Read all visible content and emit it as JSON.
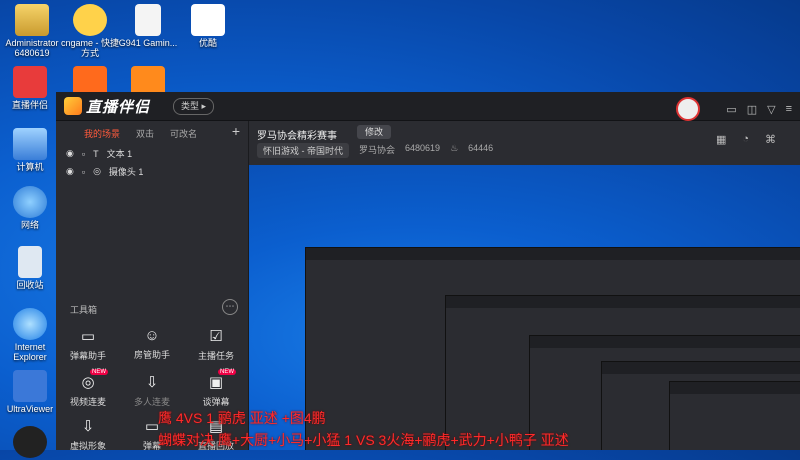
{
  "desktop": {
    "icons": [
      {
        "name": "administrator-icon",
        "label": "Administrator\n6480619",
        "color": "#4a8ad8"
      },
      {
        "name": "cngame-shortcut-icon",
        "label": "cngame - 快捷方式",
        "color": "#ffd24a"
      },
      {
        "name": "g941-file-icon",
        "label": "G941 Gamin...",
        "color": "#f2f2f2"
      },
      {
        "name": "youku-icon",
        "label": "优酷",
        "color": "#ffffff"
      },
      {
        "name": "zhibo-banlv-icon",
        "label": "直播伴侣",
        "color": "#e83b3b"
      },
      {
        "name": "game-icon-2",
        "label": "",
        "color": "#ff6a1c"
      },
      {
        "name": "game-icon-3",
        "label": "",
        "color": "#ff8a1c"
      },
      {
        "name": "computer-icon",
        "label": "计算机",
        "color": "#6fb1ff"
      },
      {
        "name": "network-icon",
        "label": "网络",
        "color": "#5ab0ff"
      },
      {
        "name": "recycle-bin-icon",
        "label": "回收站",
        "color": "#dfe8f2"
      },
      {
        "name": "ie-icon",
        "label": "Internet Explorer",
        "color": "#3fa4ff"
      },
      {
        "name": "ultraviewer-icon",
        "label": "UltraViewer",
        "color": "#3b78d8"
      },
      {
        "name": "qq-icon",
        "label": "",
        "color": "#222222"
      }
    ]
  },
  "app": {
    "logo_text": "直播伴侣",
    "type_label": "类型 ▸",
    "tabs": [
      "我的场景",
      "双击",
      "可改名"
    ],
    "sources": [
      "文本 1",
      "摄像头 1"
    ],
    "toolbox_title": "工具箱",
    "tools": [
      "弹幕助手",
      "房管助手",
      "主播任务",
      "视频连麦",
      "多人连麦",
      "谈弹幕",
      "虚拟形象",
      "弹幕",
      "直播回放"
    ],
    "room_title": "罗马协会精彩赛事",
    "edit_label": "修改",
    "category": "怀旧游戏 - 帝国时代",
    "room_name": "罗马协会",
    "room_id": "6480619",
    "popularity": "64446"
  },
  "overlay": {
    "line1": "鹰  4VS  1 鹂虎 亚述 +图4鹏",
    "line2": "蝴蝶对决 鹰+大厨+小马+小猛 1 VS 3火海+鹂虎+武力+小鸭子 亚述"
  },
  "colors": {
    "accent": "#ff5a3c",
    "overlay_text": "#ff2a2a",
    "panel_bg": "#2b2c31"
  }
}
